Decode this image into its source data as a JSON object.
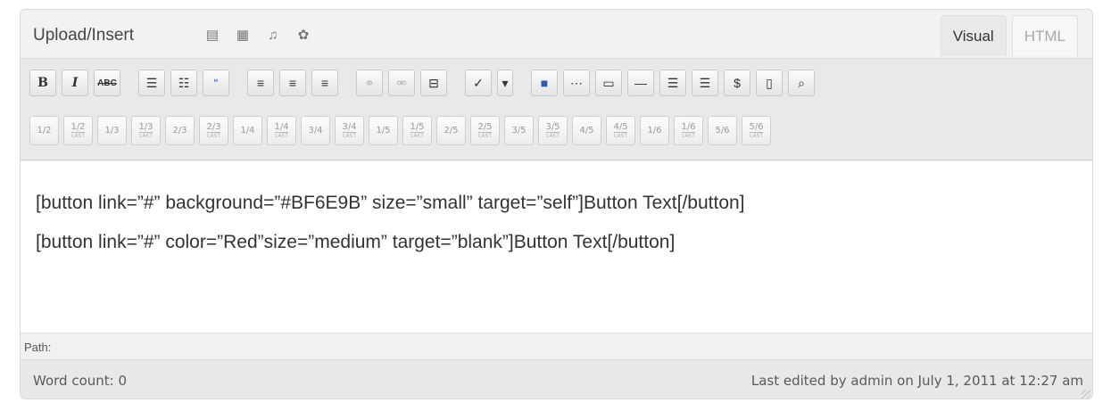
{
  "header": {
    "upload_label": "Upload/Insert",
    "media_icons": [
      "image-icon",
      "video-icon",
      "audio-icon",
      "media-icon"
    ]
  },
  "tabs": [
    {
      "label": "Visual",
      "active": true
    },
    {
      "label": "HTML",
      "active": false
    }
  ],
  "toolbar_row1": [
    {
      "name": "bold-button",
      "glyph": "B"
    },
    {
      "name": "italic-button",
      "glyph": "I"
    },
    {
      "name": "strikethrough-button",
      "glyph": "ABC"
    },
    {
      "name": "unordered-list-button",
      "glyph": "☰"
    },
    {
      "name": "ordered-list-button",
      "glyph": "☷"
    },
    {
      "name": "blockquote-button",
      "glyph": "“"
    },
    {
      "name": "align-left-button",
      "glyph": "≡"
    },
    {
      "name": "align-center-button",
      "glyph": "≡"
    },
    {
      "name": "align-right-button",
      "glyph": "≡"
    },
    {
      "name": "insert-link-button",
      "glyph": "⚭"
    },
    {
      "name": "unlink-button",
      "glyph": "⚮"
    },
    {
      "name": "insert-more-button",
      "glyph": "⊟"
    },
    {
      "name": "spellcheck-button",
      "glyph": "✓"
    },
    {
      "name": "spellcheck-dropdown",
      "glyph": "▾"
    },
    {
      "name": "fullscreen-button",
      "glyph": "■"
    },
    {
      "name": "kitchen-sink-button",
      "glyph": "⋯"
    },
    {
      "name": "shortcode-button-1",
      "glyph": "▭"
    },
    {
      "name": "shortcode-button-2",
      "glyph": "—"
    },
    {
      "name": "shortcode-button-3",
      "glyph": "☰"
    },
    {
      "name": "shortcode-button-4",
      "glyph": "☰"
    },
    {
      "name": "shortcode-button-5",
      "glyph": "$"
    },
    {
      "name": "shortcode-button-6",
      "glyph": "▯"
    },
    {
      "name": "search-button",
      "glyph": "⌕"
    }
  ],
  "columns_row": [
    {
      "frac": "1/2",
      "last": false
    },
    {
      "frac": "1/2",
      "last": true
    },
    {
      "frac": "1/3",
      "last": false
    },
    {
      "frac": "1/3",
      "last": true
    },
    {
      "frac": "2/3",
      "last": false
    },
    {
      "frac": "2/3",
      "last": true
    },
    {
      "frac": "1/4",
      "last": false
    },
    {
      "frac": "1/4",
      "last": true
    },
    {
      "frac": "3/4",
      "last": false
    },
    {
      "frac": "3/4",
      "last": true
    },
    {
      "frac": "1/5",
      "last": false
    },
    {
      "frac": "1/5",
      "last": true
    },
    {
      "frac": "2/5",
      "last": false
    },
    {
      "frac": "2/5",
      "last": true
    },
    {
      "frac": "3/5",
      "last": false
    },
    {
      "frac": "3/5",
      "last": true
    },
    {
      "frac": "4/5",
      "last": false
    },
    {
      "frac": "4/5",
      "last": true
    },
    {
      "frac": "1/6",
      "last": false
    },
    {
      "frac": "1/6",
      "last": true
    },
    {
      "frac": "5/6",
      "last": false
    },
    {
      "frac": "5/6",
      "last": true
    }
  ],
  "last_label": "LAST",
  "editor": {
    "lines": [
      "[button link=”#” background=”#BF6E9B” size=”small” target=”self”]Button Text[/button]",
      "[button link=”#” color=”Red”size=”medium” target=”blank”]Button Text[/button]"
    ]
  },
  "path_label": "Path:",
  "status": {
    "word_count": "Word count: 0",
    "last_edited": "Last edited by admin on July 1, 2011 at 12:27 am"
  }
}
